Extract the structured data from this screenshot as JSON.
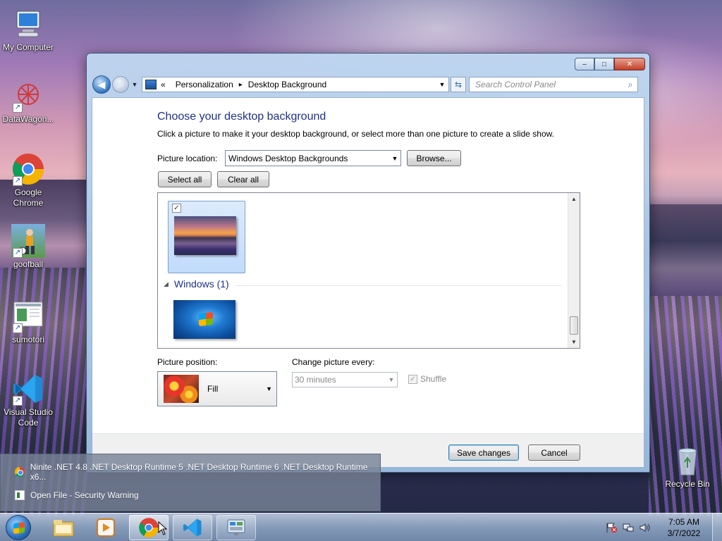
{
  "desktop": {
    "icons": [
      {
        "label": "My Computer",
        "icon": "computer-icon"
      },
      {
        "label": "DataWagon...",
        "icon": "datawagon-icon"
      },
      {
        "label": "Google Chrome",
        "icon": "chrome-icon"
      },
      {
        "label": "goofball",
        "icon": "goofball-icon"
      },
      {
        "label": "sumotori",
        "icon": "sumotori-icon"
      },
      {
        "label": "Visual Studio Code",
        "icon": "vscode-icon"
      },
      {
        "label": "Recycle Bin",
        "icon": "recycle-bin-icon"
      }
    ]
  },
  "window": {
    "caption_buttons": {
      "minimize": "–",
      "maximize": "□",
      "close": "✕"
    },
    "breadcrumb": {
      "prefix": "«",
      "items": [
        "Personalization",
        "Desktop Background"
      ],
      "separator": "▸"
    },
    "search_placeholder": "Search Control Panel",
    "heading": "Choose your desktop background",
    "description": "Click a picture to make it your desktop background, or select more than one picture to create a slide show.",
    "picture_location_label": "Picture location:",
    "picture_location_value": "Windows Desktop Backgrounds",
    "browse_label": "Browse...",
    "select_all_label": "Select all",
    "clear_all_label": "Clear all",
    "gallery": {
      "group_title": "Windows (1)",
      "first_item_checked": true
    },
    "picture_position_label": "Picture position:",
    "picture_position_value": "Fill",
    "change_picture_label": "Change picture every:",
    "change_picture_value": "30 minutes",
    "shuffle_label": "Shuffle",
    "save_label": "Save changes",
    "cancel_label": "Cancel"
  },
  "jumplist": {
    "items": [
      {
        "label": "Ninite .NET 4.8 .NET Desktop Runtime 5 .NET Desktop Runtime 6 .NET Desktop Runtime x6...",
        "icon": "chrome-icon"
      },
      {
        "label": "Open File - Security Warning",
        "icon": "file-icon"
      }
    ]
  },
  "taskbar": {
    "time": "7:05 AM",
    "date": "3/7/2022"
  }
}
